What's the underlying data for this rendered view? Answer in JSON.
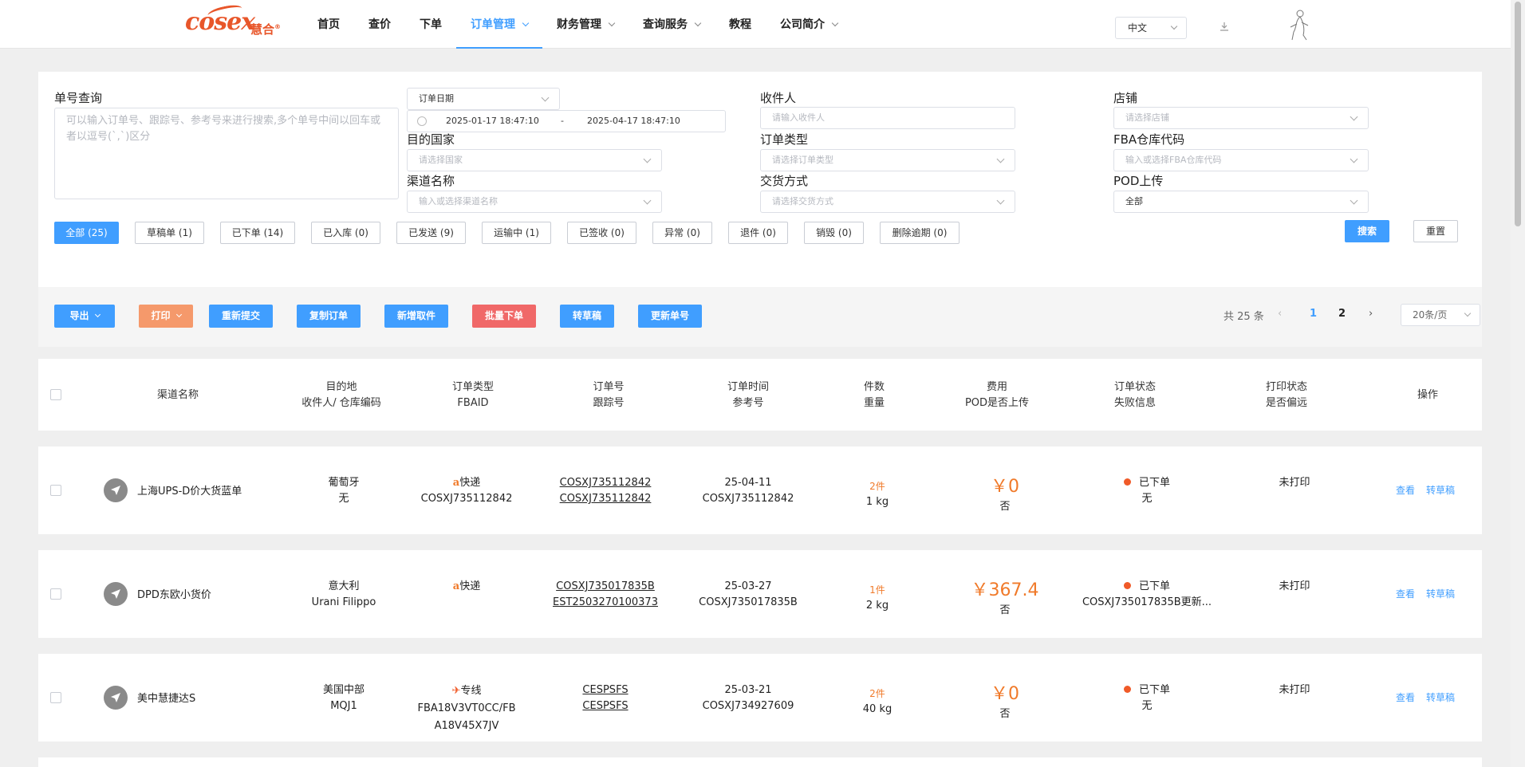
{
  "brand": {
    "logo_text": "cosex",
    "logo_cn": "慧合",
    "reg": "®"
  },
  "nav": [
    {
      "label": "首页",
      "dropdown": false
    },
    {
      "label": "查价",
      "dropdown": false
    },
    {
      "label": "下单",
      "dropdown": false
    },
    {
      "label": "订单管理",
      "dropdown": true,
      "active": true
    },
    {
      "label": "财务管理",
      "dropdown": true
    },
    {
      "label": "查询服务",
      "dropdown": true
    },
    {
      "label": "教程",
      "dropdown": false
    },
    {
      "label": "公司简介",
      "dropdown": true
    }
  ],
  "header": {
    "language": "中文",
    "download_icon": "download-icon",
    "avatar_icon": "avatar-icon"
  },
  "filter": {
    "order_no_label": "单号查询",
    "order_no_placeholder": "可以输入订单号、跟踪号、参考号来进行搜索,多个单号中间以回车或者以逗号(`,`)区分",
    "date_type": "订单日期",
    "date_start": "2025-01-17 18:47:10",
    "date_sep": "-",
    "date_end": "2025-04-17 18:47:10",
    "country_label": "目的国家",
    "country_placeholder": "请选择国家",
    "channel_label": "渠道名称",
    "channel_placeholder": "输入或选择渠道名称",
    "receiver_label": "收件人",
    "receiver_placeholder": "请输入收件人",
    "order_type_label": "订单类型",
    "order_type_placeholder": "请选择订单类型",
    "delivery_label": "交货方式",
    "delivery_placeholder": "请选择交货方式",
    "shop_label": "店铺",
    "shop_placeholder": "请选择店铺",
    "fba_label": "FBA仓库代码",
    "fba_placeholder": "输入或选择FBA仓库代码",
    "pod_label": "POD上传",
    "pod_value": "全部",
    "search_label": "搜索",
    "reset_label": "重置"
  },
  "status_tabs": [
    {
      "label": "全部 (25)",
      "active": true
    },
    {
      "label": "草稿单 (1)"
    },
    {
      "label": "已下单 (14)"
    },
    {
      "label": "已入库 (0)"
    },
    {
      "label": "已发送 (9)"
    },
    {
      "label": "运输中 (1)"
    },
    {
      "label": "已签收 (0)"
    },
    {
      "label": "异常 (0)"
    },
    {
      "label": "退件 (0)"
    },
    {
      "label": "销毁 (0)"
    },
    {
      "label": "删除逾期 (0)"
    }
  ],
  "toolbar": {
    "export": "导出",
    "print": "打印",
    "resubmit": "重新提交",
    "copy": "复制订单",
    "add_pickup": "新增取件",
    "batch_order": "批量下单",
    "to_draft": "转草稿",
    "update_no": "更新单号"
  },
  "pagination": {
    "total": "共 25 条",
    "pages": [
      "1",
      "2"
    ],
    "current": "1",
    "page_size": "20条/页"
  },
  "columns": {
    "channel": "渠道名称",
    "dest_1": "目的地",
    "dest_2": "收件人/ 仓库编码",
    "type_1": "订单类型",
    "type_2": "FBAID",
    "no_1": "订单号",
    "no_2": "跟踪号",
    "time_1": "订单时间",
    "time_2": "参考号",
    "qty_1": "件数",
    "qty_2": "重量",
    "fee_1": "费用",
    "fee_2": "POD是否上传",
    "status_1": "订单状态",
    "status_2": "失败信息",
    "print_1": "打印状态",
    "print_2": "是否偏远",
    "ops": "操作"
  },
  "rows": [
    {
      "channel": "上海UPS-D价大货蓝单",
      "dest": "葡萄牙",
      "receiver": "无",
      "type_icon": "amazon-icon",
      "type": "快递",
      "fbaid": "COSXJ735112842",
      "order_no": "COSXJ735112842",
      "tracking_no": "COSXJ735112842",
      "time": "25-04-11",
      "ref": "COSXJ735112842",
      "qty": "2件",
      "weight": "1 kg",
      "fee": "￥0",
      "pod": "否",
      "status": "已下单",
      "fail": "无",
      "print": "未打印",
      "op_view": "查看",
      "op_draft": "转草稿"
    },
    {
      "channel": "DPD东欧小货价",
      "dest": "意大利",
      "receiver": "Urani Filippo",
      "type_icon": "amazon-icon",
      "type": "快递",
      "fbaid": "",
      "order_no": "COSXJ735017835B",
      "tracking_no": "EST2503270100373",
      "time": "25-03-27",
      "ref": "COSXJ735017835B",
      "qty": "1件",
      "weight": "2 kg",
      "fee": "￥367.4",
      "pod": "否",
      "status": "已下单",
      "fail": "COSXJ735017835B更新...",
      "print": "未打印",
      "op_view": "查看",
      "op_draft": "转草稿"
    },
    {
      "channel": "美中慧捷达S",
      "dest": "美国中部",
      "receiver": "MQJ1",
      "type_icon": "plane-icon",
      "type": "专线",
      "fbaid": "FBA18V3VT0CC/FB",
      "fbaid2": "A18V45X7JV",
      "order_no": "CESPSFS",
      "tracking_no": "CESPSFS",
      "time": "25-03-21",
      "ref": "COSXJ734927609",
      "qty": "2件",
      "weight": "40 kg",
      "fee": "￥0",
      "pod": "否",
      "status": "已下单",
      "fail": "无",
      "print": "未打印",
      "op_view": "查看",
      "op_draft": "转草稿"
    }
  ]
}
